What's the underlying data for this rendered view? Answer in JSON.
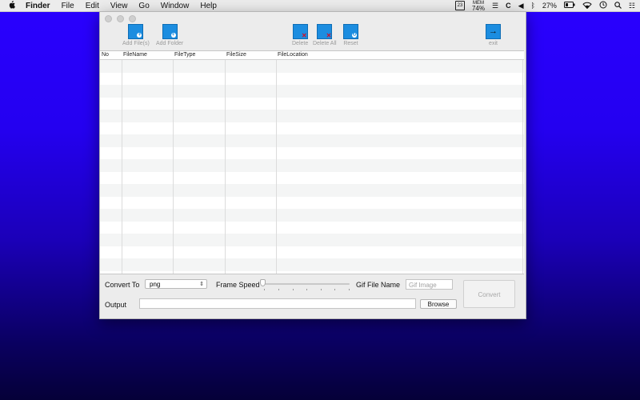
{
  "menubar": {
    "apple_icon": "apple-logo",
    "app_name": "Finder",
    "items": [
      "File",
      "Edit",
      "View",
      "Go",
      "Window",
      "Help"
    ],
    "calendar_day": "23",
    "mem_label": "MEM",
    "mem_value": "74%",
    "c_label": "C",
    "battery": "27%"
  },
  "toolbar": {
    "add_files": "Add File(s)",
    "add_folder": "Add Folder",
    "delete": "Delete",
    "delete_all": "Delete All",
    "reset": "Reset",
    "exit": "exit"
  },
  "table": {
    "columns": [
      "No",
      "FileName",
      "FileType",
      "FileSize",
      "FileLocation"
    ],
    "rows": []
  },
  "bottom": {
    "convert_to_label": "Convert To",
    "convert_to_value": "png",
    "frame_speed_label": "Frame Speed",
    "gif_name_label": "Gif File Name",
    "gif_name_placeholder": "Gif Image",
    "convert_button": "Convert",
    "output_label": "Output",
    "output_value": "",
    "browse_button": "Browse"
  },
  "colors": {
    "accent_icon": "#1c8de0",
    "desktop_top": "#2a00ff",
    "desktop_bottom": "#050038"
  }
}
